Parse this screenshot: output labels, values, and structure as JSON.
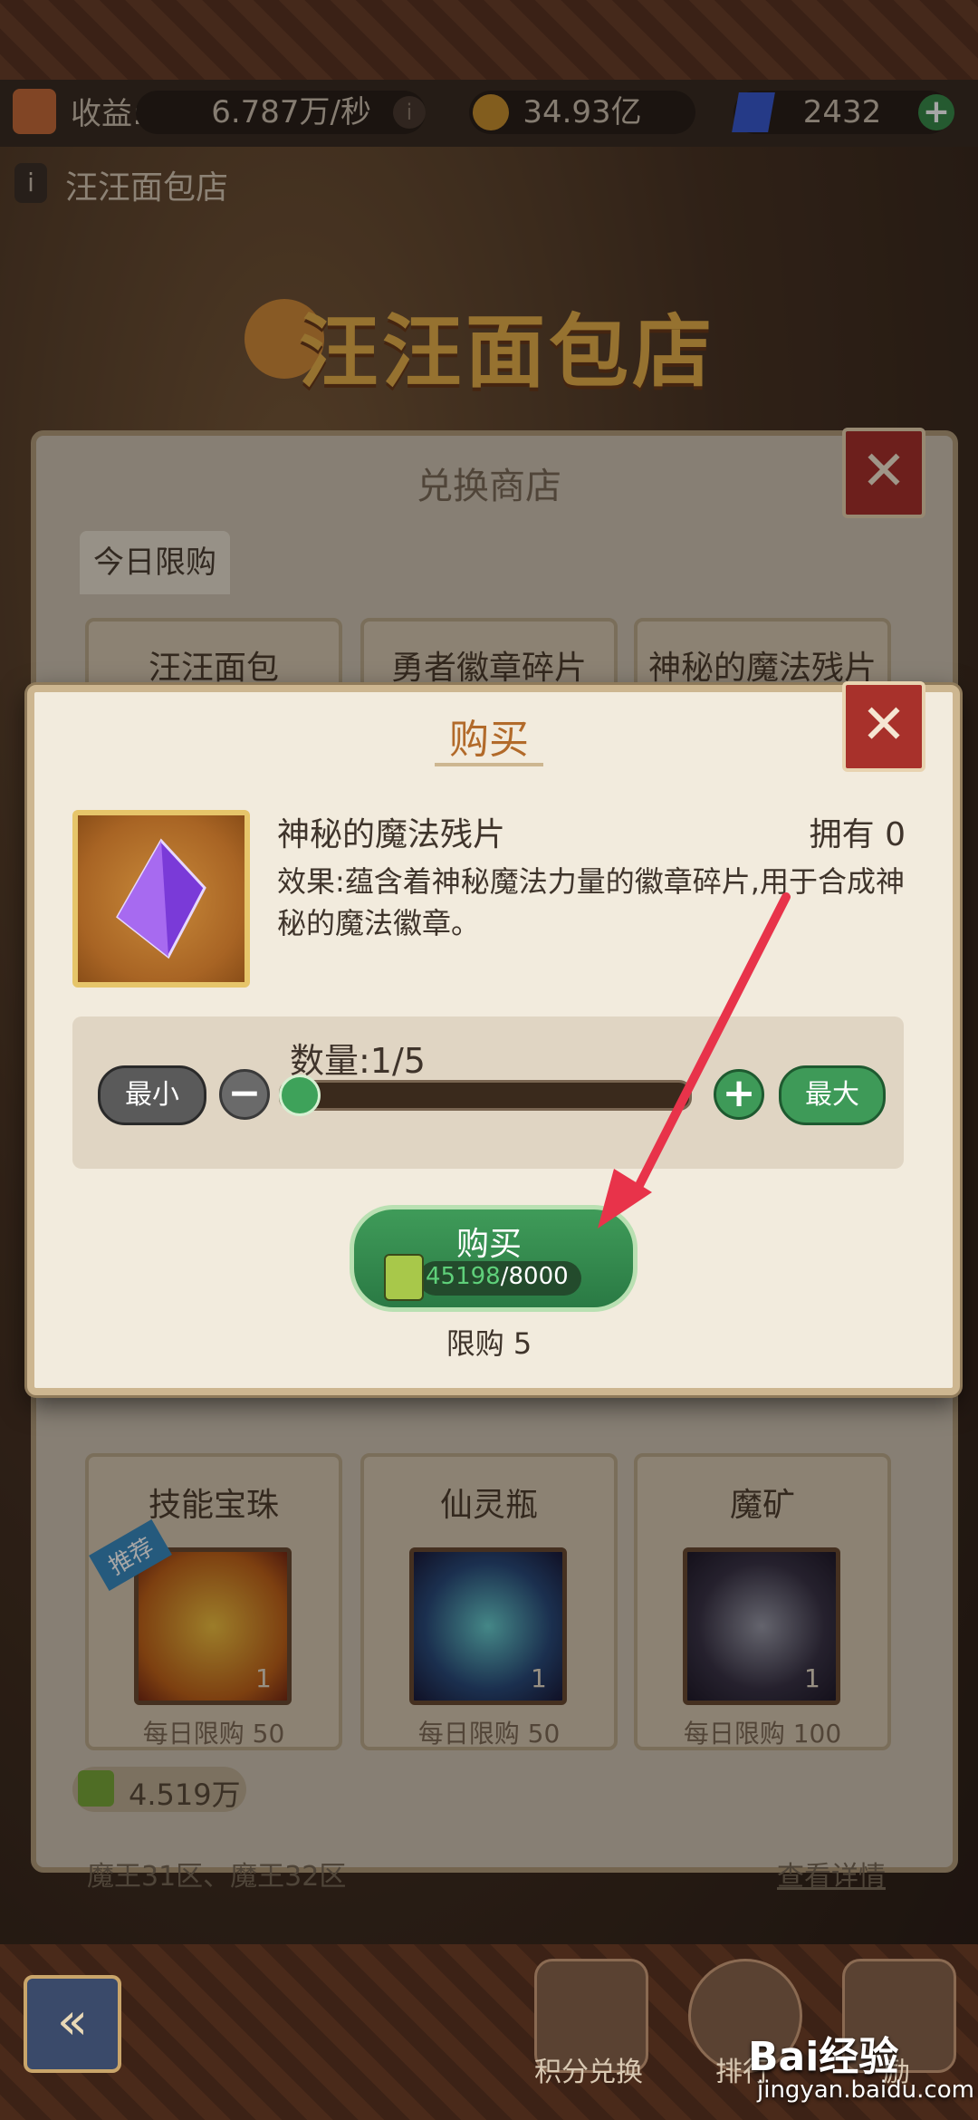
{
  "status_bar": {
    "income_label": "收益:",
    "income_value": "6.787万/秒",
    "info_icon": "info-icon",
    "coins_value": "34.93亿",
    "gems_value": "2432",
    "add_icon": "plus-icon"
  },
  "location": {
    "info_icon": "info-icon",
    "name": "汪汪面包店"
  },
  "banner": {
    "title": "汪汪面包店"
  },
  "exchange_shop": {
    "title": "兑换商店",
    "tab_today": "今日限购",
    "items_row1": [
      {
        "name": "汪汪面包"
      },
      {
        "name": "勇者徽章碎片"
      },
      {
        "name": "神秘的魔法残片"
      }
    ],
    "items_row2": [
      {
        "name": "技能宝珠",
        "badge": "推荐",
        "count": "1",
        "limit": "每日限购 50"
      },
      {
        "name": "仙灵瓶",
        "count": "1",
        "limit": "每日限购 50"
      },
      {
        "name": "魔矿",
        "count": "1",
        "limit": "每日限购 100"
      }
    ],
    "currency_value": "4.519万",
    "server_text": "魔王31区、魔王32区",
    "details_link": "查看详情"
  },
  "buy_modal": {
    "title": "购买",
    "item_name": "神秘的魔法残片",
    "owned": "拥有 0",
    "description": "效果:蕴含着神秘魔法力量的徽章碎片,用于合成神秘的魔法徽章。",
    "quantity_label": "数量:1/5",
    "quantity_fraction": 0.0,
    "min_label": "最小",
    "max_label": "最大",
    "buy_label": "购买",
    "price_owned": "45198",
    "price_sep_cost": "/8000",
    "limit_text": "限购 5"
  },
  "bottom_nav": {
    "back_icon": "back-arrow-icon",
    "items": [
      {
        "label": "积分兑换"
      },
      {
        "label": "排行"
      },
      {
        "label": "励"
      }
    ]
  },
  "watermark": {
    "brand": "Bai经验",
    "url": "jingyan.baidu.com"
  },
  "colors": {
    "accent_green": "#3e9a58",
    "close_red": "#a8312b",
    "title_orange": "#b26a2a",
    "arrow_red": "#e8334a"
  }
}
